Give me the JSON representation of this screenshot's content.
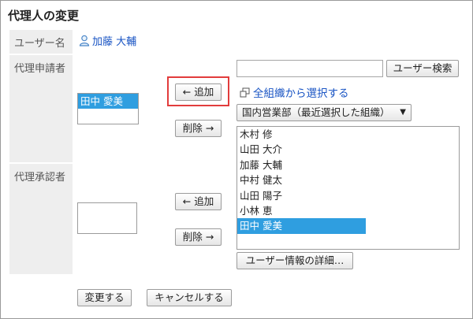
{
  "page_title": "代理人の変更",
  "user_field": {
    "label": "ユーザー名",
    "value": "加藤 大輔"
  },
  "applicant_section": {
    "label": "代理申請者",
    "selected_list": [
      "田中 愛美"
    ],
    "add_button": "← 追加",
    "remove_button": "削除 →"
  },
  "approver_section": {
    "label": "代理承認者",
    "selected_list": [],
    "add_button": "← 追加",
    "remove_button": "削除 →"
  },
  "search": {
    "input_value": "",
    "button": "ユーザー検索"
  },
  "org_select_link": "全組織から選択する",
  "org_dropdown": {
    "selected": "国内営業部（最近選択した組織）"
  },
  "candidate_list": {
    "items": [
      "木村 修",
      "山田 大介",
      "加藤 大輔",
      "中村 健太",
      "山田 陽子",
      "小林 恵",
      "田中 愛美"
    ],
    "selected_index": 6
  },
  "user_detail_button": "ユーザー情報の詳細…",
  "footer": {
    "submit": "変更する",
    "cancel": "キャンセルする"
  },
  "colors": {
    "selection": "#2f9ee0",
    "link": "#1a55c4",
    "highlight_border": "#e23c3c"
  }
}
